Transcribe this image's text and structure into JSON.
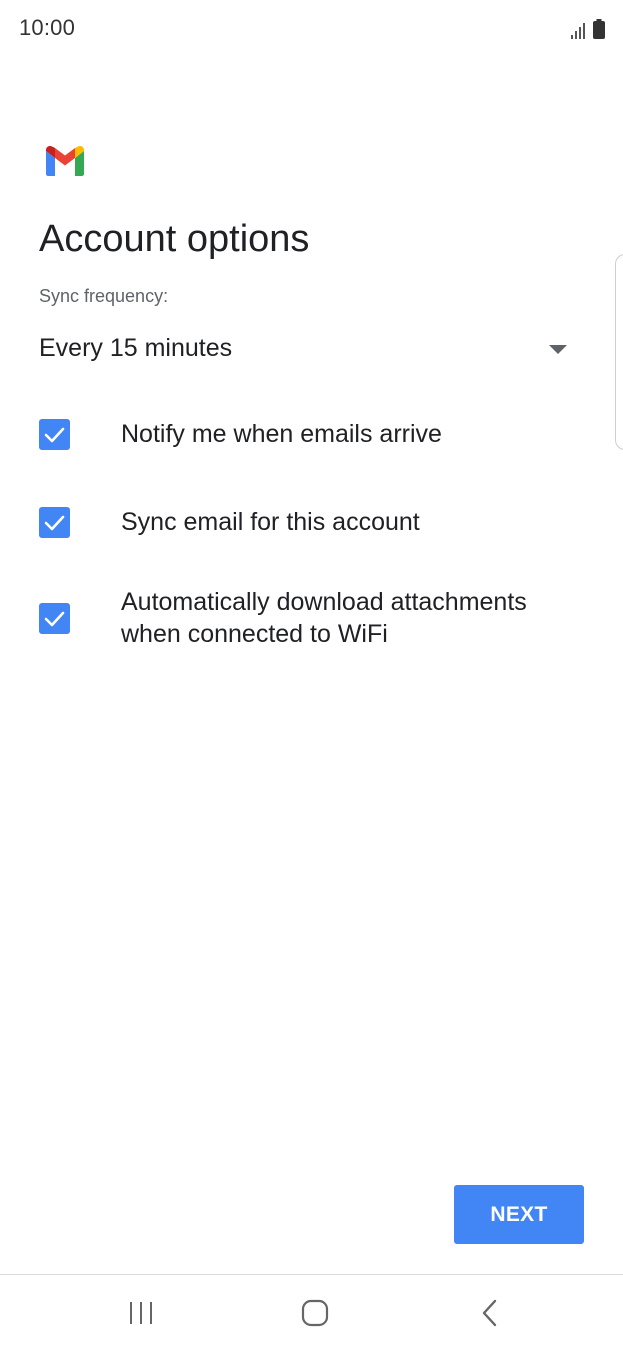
{
  "status_bar": {
    "time": "10:00",
    "icons": [
      "signal-icon",
      "battery-icon"
    ]
  },
  "app": {
    "logo": "gmail-logo-icon",
    "colors": {
      "accent": "#4285f4",
      "gmail_red": "#ea4335",
      "gmail_yellow": "#fbbc04",
      "gmail_green": "#34a853",
      "gmail_blue": "#4285f4"
    }
  },
  "page": {
    "title": "Account options"
  },
  "sync": {
    "label": "Sync frequency:",
    "selected": "Every 15 minutes"
  },
  "options": [
    {
      "label": "Notify me when emails arrive",
      "checked": true
    },
    {
      "label": "Sync email for this account",
      "checked": true
    },
    {
      "label": "Automatically download attachments when connected to WiFi",
      "checked": true
    }
  ],
  "actions": {
    "next_label": "NEXT"
  },
  "nav_bar": {
    "items": [
      "recent-apps-icon",
      "home-icon",
      "back-icon"
    ]
  }
}
